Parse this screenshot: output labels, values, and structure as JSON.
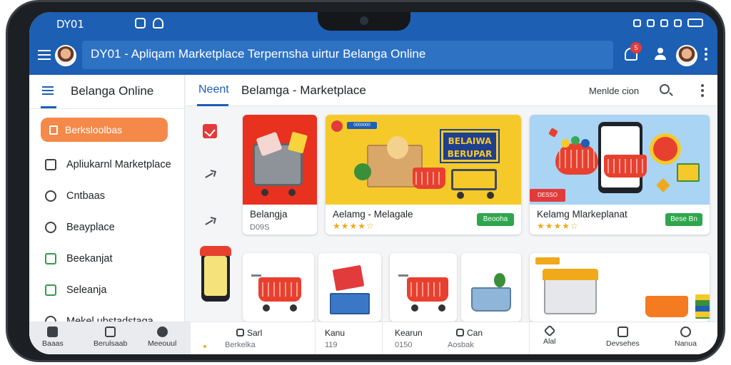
{
  "status": {
    "time": "DY01"
  },
  "appbar": {
    "title": "DY01 - Apliqam Marketplace Terpernsha uirtur Belanga Online",
    "badge_count": "5"
  },
  "sidebar": {
    "title": "Belanga Online",
    "active_item": "Berksloolbas",
    "items": [
      {
        "label": "Apliukarnl Marketplace"
      },
      {
        "label": "Cntbaas"
      },
      {
        "label": "Beayplace"
      },
      {
        "label": "Beekanjat"
      },
      {
        "label": "Seleanja"
      },
      {
        "label": "Mekel ubstadstaga"
      }
    ]
  },
  "tabs": {
    "active": "Neent",
    "main": "Belamga - Marketplace",
    "search_label": "Menlde cion"
  },
  "cards": {
    "c1": {
      "title": "Belangja",
      "sub": "D09S"
    },
    "c2": {
      "title": "Aelamg - Melagale",
      "stars": "★★★★☆",
      "button": "Beooha",
      "banner_line1": "BELAIWA",
      "banner_line2": "BERUPAR",
      "tag": "0000000"
    },
    "c3": {
      "title": "Kelamg Mlarkeplanat",
      "stars": "★★★★☆",
      "button": "Bese Bn",
      "tag": "DESSO"
    }
  },
  "bottomnav": {
    "left_items": [
      {
        "label": "Baaas"
      },
      {
        "label": "Berulsaab"
      },
      {
        "label": "Meeouul"
      }
    ],
    "seg1_title": "Sarl",
    "seg1_sub": "Berkelka",
    "seg2_title": "Kanu",
    "seg2_sub": "119",
    "seg3_title": "Kearun",
    "seg3_sub": "0150",
    "seg4_title": "Can",
    "seg4_sub": "Aosbak",
    "right_items": [
      {
        "label": "Alal"
      },
      {
        "label": "Devsehes"
      },
      {
        "label": "Nanua"
      }
    ]
  },
  "colors": {
    "primary": "#1d5fb3",
    "accent_orange": "#f5894a",
    "buy_green": "#2ea64b",
    "badge_red": "#e23b3b"
  }
}
